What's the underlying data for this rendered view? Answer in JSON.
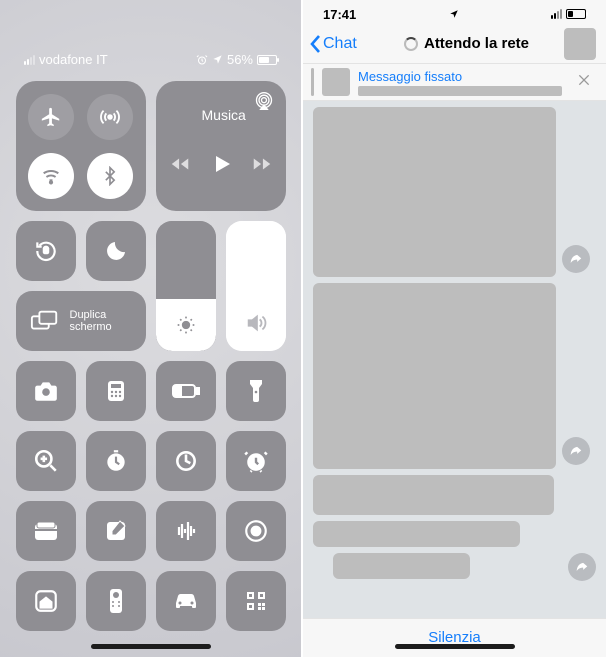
{
  "control_center": {
    "status": {
      "carrier": "vodafone IT",
      "battery_pct": "56%",
      "alarm_icon": "alarm-icon",
      "location_icon": "location-icon"
    },
    "connectivity": {
      "airplane": {
        "label": "Airplane Mode",
        "on": false
      },
      "cellular": {
        "label": "Cellular Data",
        "on": false
      },
      "wifi": {
        "label": "Wi-Fi",
        "on": true
      },
      "bluetooth": {
        "label": "Bluetooth",
        "on": true
      }
    },
    "music": {
      "title": "Musica",
      "airplay_icon": "airplay-audio-icon"
    },
    "rotation_lock": {
      "label": "Rotation Lock",
      "on": true
    },
    "dnd": {
      "label": "Do Not Disturb",
      "on": false
    },
    "screen_mirror": {
      "label_line1": "Duplica",
      "label_line2": "schermo"
    },
    "shortcuts": [
      {
        "name": "camera-icon",
        "label": "Camera"
      },
      {
        "name": "calculator-icon",
        "label": "Calculator"
      },
      {
        "name": "low-power-icon",
        "label": "Low Power Mode"
      },
      {
        "name": "flashlight-icon",
        "label": "Flashlight"
      },
      {
        "name": "magnifier-icon",
        "label": "Magnifier"
      },
      {
        "name": "stopwatch-icon",
        "label": "Stopwatch"
      },
      {
        "name": "timer-icon",
        "label": "Timer"
      },
      {
        "name": "alarm-icon",
        "label": "Alarm"
      },
      {
        "name": "wallet-icon",
        "label": "Wallet"
      },
      {
        "name": "note-icon",
        "label": "Notes"
      },
      {
        "name": "voice-memo-icon",
        "label": "Voice Memos"
      },
      {
        "name": "screen-record-icon",
        "label": "Screen Recording"
      },
      {
        "name": "home-icon",
        "label": "Home"
      },
      {
        "name": "remote-icon",
        "label": "Apple TV Remote"
      },
      {
        "name": "carplay-icon",
        "label": "Do Not Disturb While Driving"
      },
      {
        "name": "qr-icon",
        "label": "Scan QR Code"
      }
    ]
  },
  "telegram": {
    "status": {
      "time": "17:41"
    },
    "nav": {
      "back_label": "Chat",
      "title": "Attendo la rete"
    },
    "pinned": {
      "title": "Messaggio fissato"
    },
    "bottom": {
      "mute_label": "Silenzia"
    }
  }
}
